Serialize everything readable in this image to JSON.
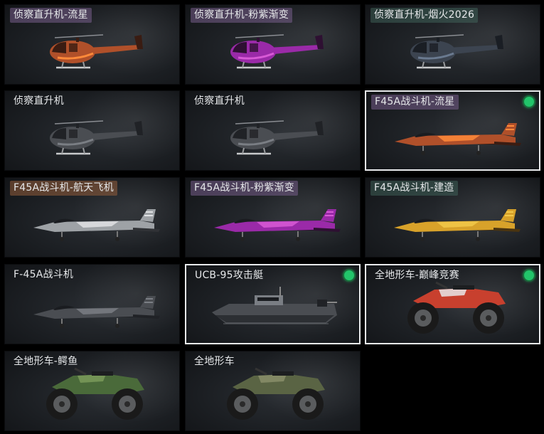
{
  "tiles": [
    {
      "label": "侦察直升机-流星",
      "kind": "heli",
      "skin": "meteor",
      "selected": false,
      "equipped": false,
      "label_tint": "purple"
    },
    {
      "label": "侦察直升机-粉紫渐变",
      "kind": "heli",
      "skin": "pink",
      "selected": false,
      "equipped": false,
      "label_tint": "purple"
    },
    {
      "label": "侦察直升机-烟火2026",
      "kind": "heli",
      "skin": "firework",
      "selected": false,
      "equipped": false,
      "label_tint": "teal"
    },
    {
      "label": "侦察直升机",
      "kind": "heli",
      "skin": "default",
      "selected": false,
      "equipped": false,
      "label_tint": "none"
    },
    {
      "label": "侦察直升机",
      "kind": "heli",
      "skin": "default",
      "selected": false,
      "equipped": false,
      "label_tint": "none"
    },
    {
      "label": "F45A战斗机-流星",
      "kind": "jet",
      "skin": "meteor",
      "selected": true,
      "equipped": true,
      "label_tint": "purple"
    },
    {
      "label": "F45A战斗机-航天飞机",
      "kind": "jet",
      "skin": "shuttle",
      "selected": false,
      "equipped": false,
      "label_tint": "orange"
    },
    {
      "label": "F45A战斗机-粉紫渐变",
      "kind": "jet",
      "skin": "pink",
      "selected": false,
      "equipped": false,
      "label_tint": "purple"
    },
    {
      "label": "F45A战斗机-建造",
      "kind": "jet",
      "skin": "construction",
      "selected": false,
      "equipped": false,
      "label_tint": "teal"
    },
    {
      "label": "F-45A战斗机",
      "kind": "jet",
      "skin": "default",
      "selected": false,
      "equipped": false,
      "label_tint": "none"
    },
    {
      "label": "UCB-95攻击艇",
      "kind": "boat",
      "skin": "default",
      "selected": true,
      "equipped": true,
      "label_tint": "none"
    },
    {
      "label": "全地形车-巅峰竞赛",
      "kind": "atv",
      "skin": "racing",
      "selected": true,
      "equipped": true,
      "label_tint": "none"
    },
    {
      "label": "全地形车-鳄鱼",
      "kind": "atv",
      "skin": "croc",
      "selected": false,
      "equipped": false,
      "label_tint": "none"
    },
    {
      "label": "全地形车",
      "kind": "atv",
      "skin": "camo",
      "selected": false,
      "equipped": false,
      "label_tint": "none"
    }
  ],
  "skin_colors": {
    "meteor": {
      "body": "#b0502a",
      "accent": "#ff8a3a",
      "dark": "#3a1c12"
    },
    "pink": {
      "body": "#9a2aa8",
      "accent": "#d85ad6",
      "dark": "#2e1032"
    },
    "firework": {
      "body": "#3c4450",
      "accent": "#6a7a90",
      "dark": "#1a1e24"
    },
    "default": {
      "body": "#4a4d52",
      "accent": "#7a7e84",
      "dark": "#202226"
    },
    "shuttle": {
      "body": "#9ea2a6",
      "accent": "#e0e2e4",
      "dark": "#303236"
    },
    "construction": {
      "body": "#d8a22a",
      "accent": "#f2c94a",
      "dark": "#4a3410"
    },
    "racing": {
      "body": "#c8402e",
      "accent": "#e8e8e8",
      "dark": "#2a2a2a"
    },
    "croc": {
      "body": "#4a6a3a",
      "accent": "#7a9a5a",
      "dark": "#1e2a18"
    },
    "camo": {
      "body": "#5a6444",
      "accent": "#8a8e6a",
      "dark": "#22261a"
    }
  },
  "status_color": "#22c46a"
}
